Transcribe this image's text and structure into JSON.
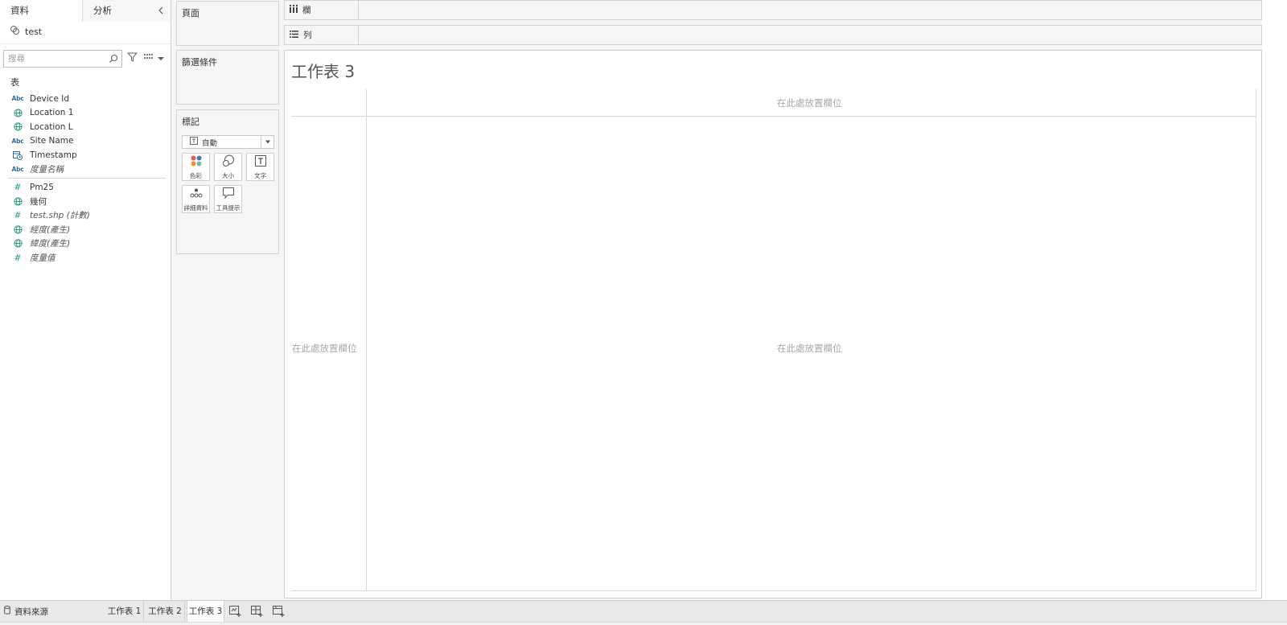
{
  "left_pane": {
    "tab_data": "資料",
    "tab_analytics": "分析",
    "datasource_name": "test",
    "search_placeholder": "搜尋",
    "section_title": "表",
    "dimensions": [
      {
        "type": "abc",
        "label": "Device Id",
        "italic": false
      },
      {
        "type": "geo",
        "label": "Location 1",
        "italic": false
      },
      {
        "type": "geo",
        "label": "Location L",
        "italic": false
      },
      {
        "type": "abc",
        "label": "Site Name",
        "italic": false
      },
      {
        "type": "datetime",
        "label": "Timestamp",
        "italic": false
      },
      {
        "type": "abc",
        "label": "度量名稱",
        "italic": true
      }
    ],
    "measures": [
      {
        "type": "hash",
        "label": "Pm25",
        "italic": false
      },
      {
        "type": "geo",
        "label": "幾何",
        "italic": false
      },
      {
        "type": "hash",
        "label": "test.shp (計數)",
        "italic": true
      },
      {
        "type": "geo",
        "label": "經度(產生)",
        "italic": true
      },
      {
        "type": "geo",
        "label": "緯度(產生)",
        "italic": true
      },
      {
        "type": "hash",
        "label": "度量值",
        "italic": true
      }
    ]
  },
  "cards": {
    "pages_title": "頁面",
    "filters_title": "篩選條件",
    "marks_title": "標記",
    "mark_type": "自動",
    "mark_buttons": {
      "color": "色彩",
      "size": "大小",
      "text": "文字",
      "detail": "詳細資料",
      "tooltip": "工具提示"
    }
  },
  "shelves": {
    "columns_label": "欄",
    "rows_label": "列"
  },
  "worksheet": {
    "title": "工作表 3",
    "drop_hint_columns": "在此處放置欄位",
    "drop_hint_rows": "在此處放置欄位",
    "drop_hint_main": "在此處放置欄位"
  },
  "bottom_bar": {
    "datasource_tab": "資料來源",
    "sheet_tabs": [
      "工作表 1",
      "工作表 2",
      "工作表 3"
    ],
    "active_tab": "工作表 3"
  },
  "colors": {
    "accent_blue": "#2f6e9a",
    "geo_green": "#2e9b7a",
    "hint_gray": "#a8a8a8"
  }
}
